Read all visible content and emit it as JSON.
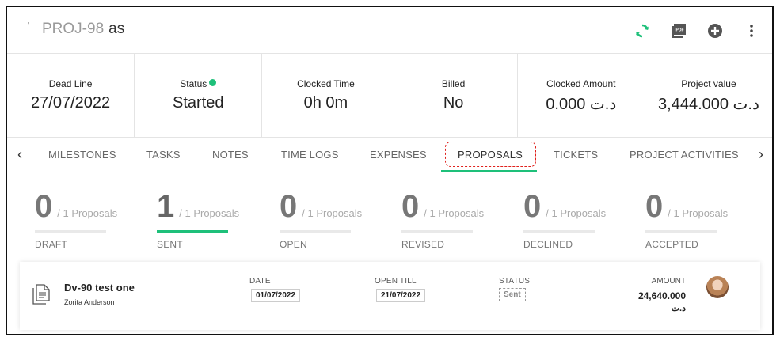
{
  "header": {
    "mark": "'",
    "project_code": "PROJ-98",
    "project_suffix": "as",
    "icons": [
      "refresh-icon",
      "pdf-icon",
      "add-icon",
      "more-vertical-icon"
    ]
  },
  "stats": [
    {
      "label": "Dead Line",
      "value": "27/07/2022"
    },
    {
      "label": "Status",
      "value": "Started"
    },
    {
      "label": "Clocked Time",
      "value": "0h 0m"
    },
    {
      "label": "Billed",
      "value": "No"
    },
    {
      "label": "Clocked Amount",
      "value": "د.ت 0.000"
    },
    {
      "label": "Project value",
      "value": "د.ت 3,444.000"
    }
  ],
  "tabs": [
    "MILESTONES",
    "TASKS",
    "NOTES",
    "TIME LOGS",
    "EXPENSES",
    "PROPOSALS",
    "TICKETS",
    "PROJECT ACTIVITIES"
  ],
  "active_tab": "PROPOSALS",
  "counters": [
    {
      "count": "0",
      "total": "/ 1 Proposals",
      "label": "DRAFT"
    },
    {
      "count": "1",
      "total": "/ 1 Proposals",
      "label": "SENT"
    },
    {
      "count": "0",
      "total": "/ 1 Proposals",
      "label": "OPEN"
    },
    {
      "count": "0",
      "total": "/ 1 Proposals",
      "label": "REVISED"
    },
    {
      "count": "0",
      "total": "/ 1 Proposals",
      "label": "DECLINED"
    },
    {
      "count": "0",
      "total": "/ 1 Proposals",
      "label": "ACCEPTED"
    }
  ],
  "proposal": {
    "title": "Dv-90  test one",
    "client": "Zorita Anderson",
    "date_label": "DATE",
    "date": "01/07/2022",
    "open_till_label": "OPEN TILL",
    "open_till": "21/07/2022",
    "status_label": "STATUS",
    "status": "Sent",
    "amount_label": "AMOUNT",
    "amount": "24,640.000",
    "currency": "د.ت"
  },
  "colors": {
    "accent": "#1ec07a",
    "highlight": "#e0201c"
  }
}
